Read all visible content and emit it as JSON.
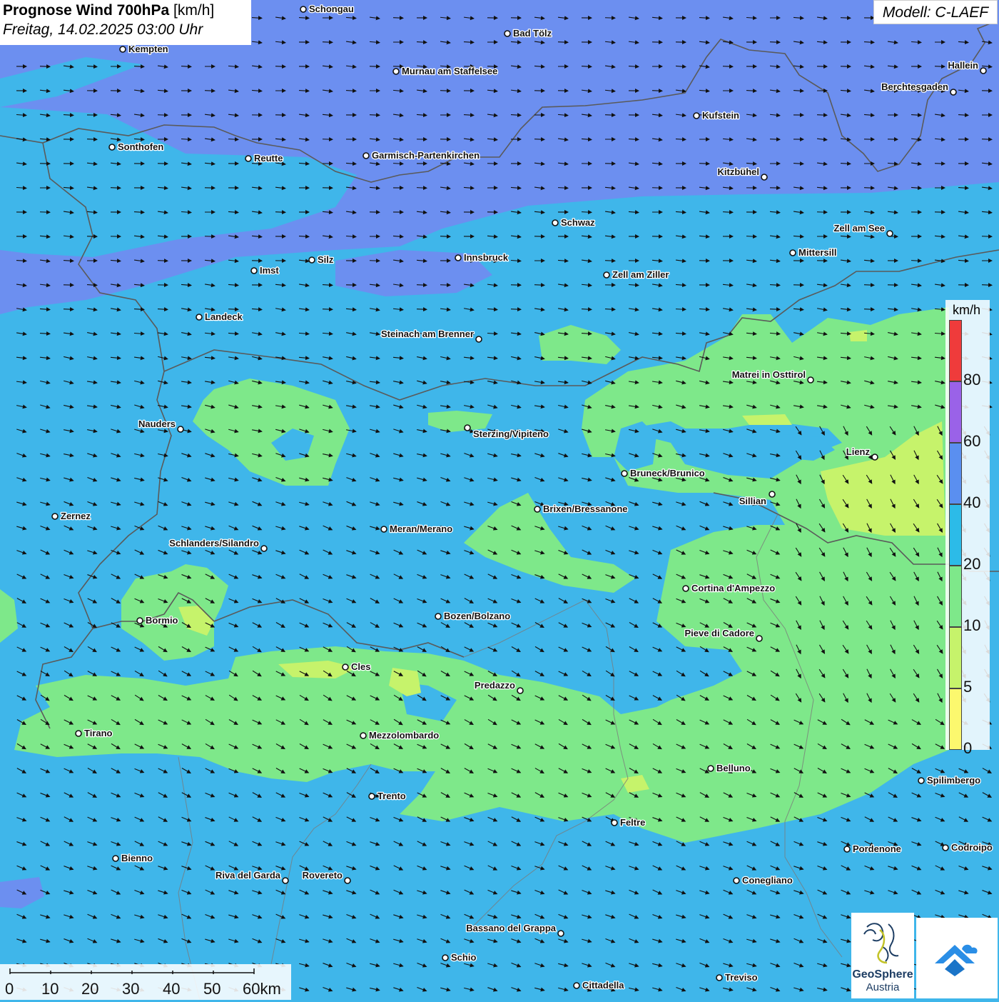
{
  "title": {
    "main": "Prognose Wind 700hPa",
    "unit": "[km/h]",
    "datetime": "Freitag, 14.02.2025 03:00 Uhr"
  },
  "model": "Modell: C-LAEF",
  "legend": {
    "unit": "km/h",
    "ticks": [
      "80",
      "60",
      "40",
      "20",
      "10",
      "5",
      "0"
    ],
    "colors": [
      "#ef3b3b",
      "#9a62e8",
      "#5a8ff0",
      "#2cbbe8",
      "#7ee88a",
      "#c6f36b",
      "#fcf86e"
    ]
  },
  "scalebar": {
    "labels": [
      "0",
      "10",
      "20",
      "30",
      "40",
      "50",
      "60km"
    ]
  },
  "logo": {
    "name1": "GeoSphere",
    "name2": "Austria"
  },
  "cities": [
    {
      "name": "Schongau"
    },
    {
      "name": "Bad Tölz"
    },
    {
      "name": "Kempten"
    },
    {
      "name": "Murnau am Staffelsee"
    },
    {
      "name": "Hallein"
    },
    {
      "name": "Berchtesgaden"
    },
    {
      "name": "Kufstein"
    },
    {
      "name": "Sonthofen"
    },
    {
      "name": "Reutte"
    },
    {
      "name": "Garmisch-Partenkirchen"
    },
    {
      "name": "Kitzbühel"
    },
    {
      "name": "Schwaz"
    },
    {
      "name": "Zell am See"
    },
    {
      "name": "Mittersill"
    },
    {
      "name": "Innsbruck"
    },
    {
      "name": "Silz"
    },
    {
      "name": "Imst"
    },
    {
      "name": "Zell am Ziller"
    },
    {
      "name": "Landeck"
    },
    {
      "name": "Steinach am Brenner"
    },
    {
      "name": "Matrei in Osttirol"
    },
    {
      "name": "Nauders"
    },
    {
      "name": "Sterzing/Vipiteno"
    },
    {
      "name": "Lienz"
    },
    {
      "name": "Bruneck/Brunico"
    },
    {
      "name": "Sillian"
    },
    {
      "name": "Zernez"
    },
    {
      "name": "Brixen/Bressanone"
    },
    {
      "name": "Meran/Merano"
    },
    {
      "name": "Schlanders/Silandro"
    },
    {
      "name": "Cortina d'Ampezzo"
    },
    {
      "name": "Bozen/Bolzano"
    },
    {
      "name": "Bormio"
    },
    {
      "name": "Pieve di Cadore"
    },
    {
      "name": "Cles"
    },
    {
      "name": "Predazzo"
    },
    {
      "name": "Tirano"
    },
    {
      "name": "Mezzolombardo"
    },
    {
      "name": "Belluno"
    },
    {
      "name": "Spilimbergo"
    },
    {
      "name": "Trento"
    },
    {
      "name": "Feltre"
    },
    {
      "name": "Pordenone"
    },
    {
      "name": "Codroipo"
    },
    {
      "name": "Bienno"
    },
    {
      "name": "Riva del Garda"
    },
    {
      "name": "Rovereto"
    },
    {
      "name": "Conegliano"
    },
    {
      "name": "Bassano del Grappa"
    },
    {
      "name": "Schio"
    },
    {
      "name": "Treviso"
    },
    {
      "name": "Cittadella"
    }
  ]
}
